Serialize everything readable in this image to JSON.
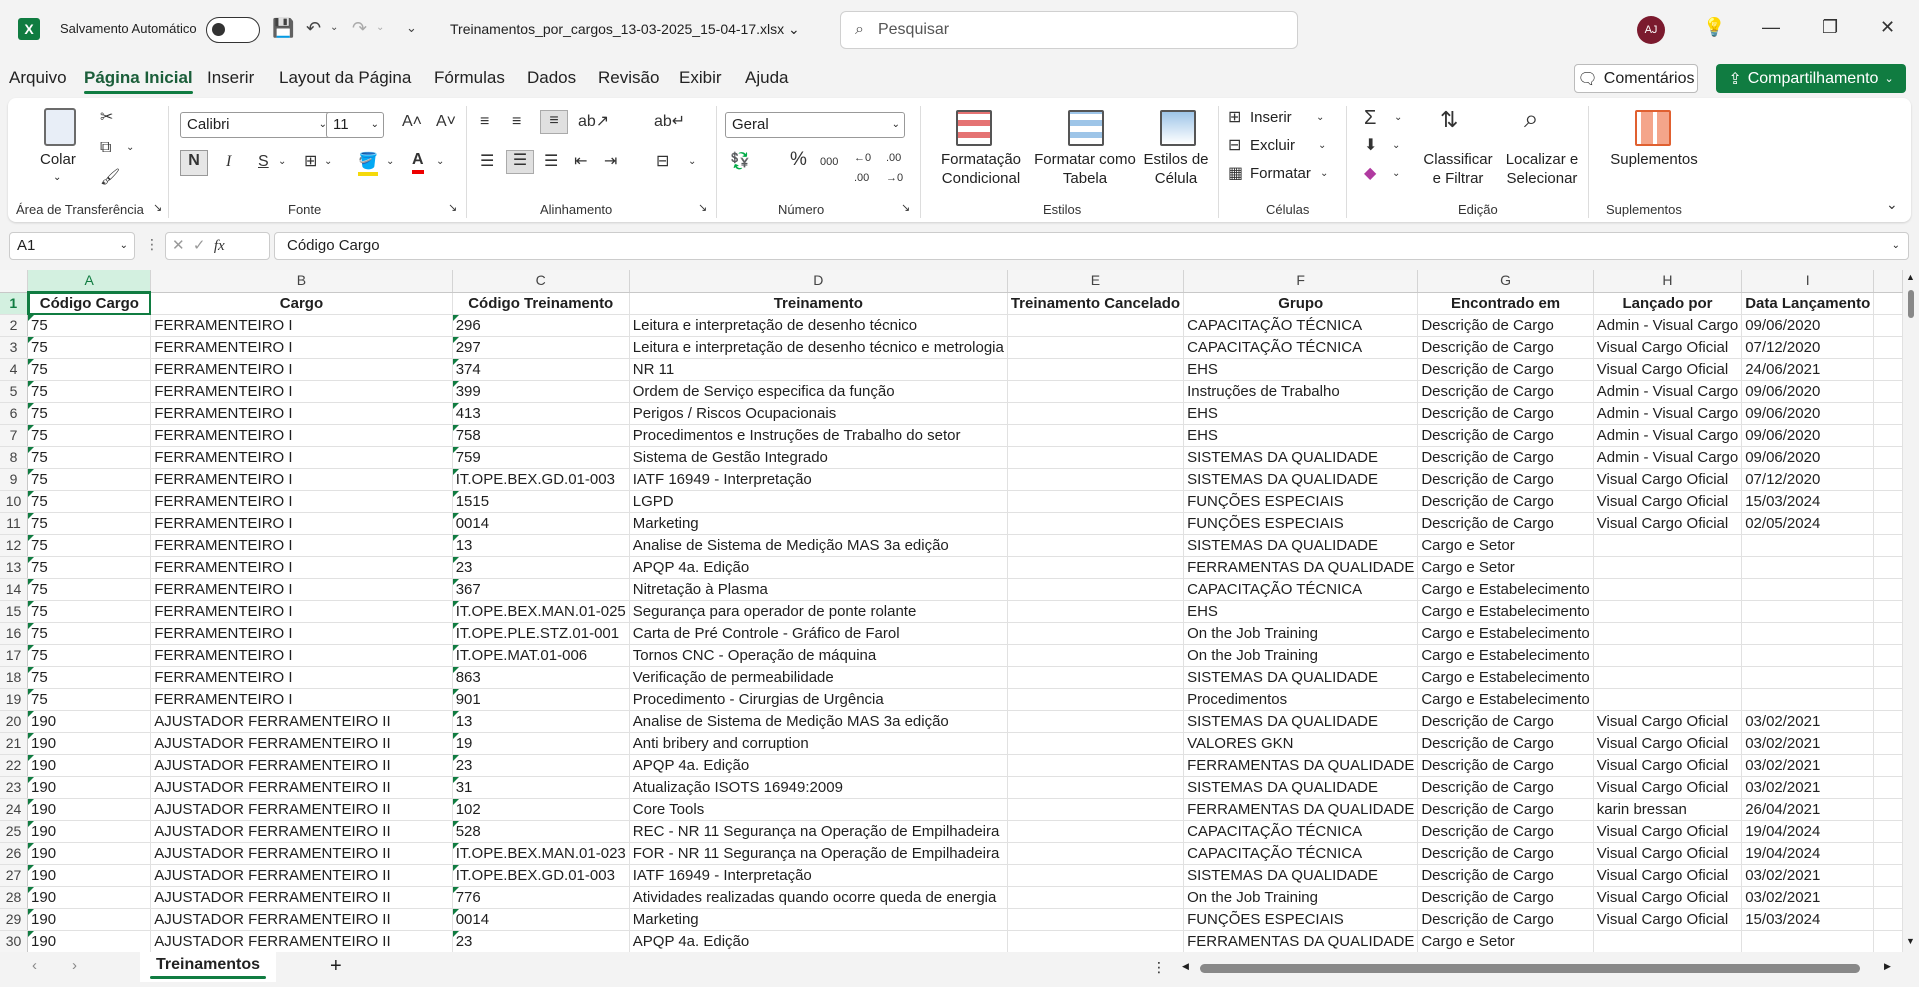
{
  "titlebar": {
    "logo": "X",
    "autosave_label": "Salvamento Automático",
    "filename": "Treinamentos_por_cargos_13-03-2025_15-04-17.xlsx",
    "search_placeholder": "Pesquisar",
    "avatar_initials": "AJ"
  },
  "menu": {
    "tabs": [
      "Arquivo",
      "Página Inicial",
      "Inserir",
      "Layout da Página",
      "Fórmulas",
      "Dados",
      "Revisão",
      "Exibir",
      "Ajuda"
    ],
    "active_tab": "Página Inicial",
    "comments": "Comentários",
    "share": "Compartilhamento"
  },
  "ribbon": {
    "clipboard": {
      "paste": "Colar",
      "label": "Área de Transferência"
    },
    "font": {
      "name": "Calibri",
      "size": "11",
      "label": "Fonte"
    },
    "alignment": {
      "label": "Alinhamento"
    },
    "number": {
      "format": "Geral",
      "label": "Número"
    },
    "styles": {
      "conditional": "Formatação Condicional",
      "table": "Formatar como Tabela",
      "cell": "Estilos de Célula",
      "label": "Estilos"
    },
    "cells": {
      "insert": "Inserir",
      "delete": "Excluir",
      "format": "Formatar",
      "label": "Células"
    },
    "editing": {
      "sort": "Classificar e Filtrar",
      "find": "Localizar e Selecionar",
      "label": "Edição"
    },
    "addins": {
      "addins": "Suplementos",
      "label": "Suplementos"
    }
  },
  "formula_bar": {
    "name_box": "A1",
    "formula": "Código Cargo"
  },
  "grid": {
    "columns": [
      "A",
      "B",
      "C",
      "D",
      "E",
      "F",
      "G",
      "H",
      "I"
    ],
    "headers": [
      "Código Cargo",
      "Cargo",
      "Código Treinamento",
      "Treinamento",
      "Treinamento Cancelado",
      "Grupo",
      "Encontrado em",
      "Lançado por",
      "Data Lançamento"
    ],
    "rows": [
      [
        "75",
        "FERRAMENTEIRO I",
        "296",
        "Leitura e interpretação de desenho técnico",
        "",
        "CAPACITAÇÃO TÉCNICA",
        "Descrição de Cargo",
        "Admin - Visual Cargo",
        "09/06/2020"
      ],
      [
        "75",
        "FERRAMENTEIRO I",
        "297",
        "Leitura e interpretação de desenho técnico e metrologia",
        "",
        "CAPACITAÇÃO TÉCNICA",
        "Descrição de Cargo",
        "Visual Cargo Oficial",
        "07/12/2020"
      ],
      [
        "75",
        "FERRAMENTEIRO I",
        "374",
        "NR 11",
        "",
        "EHS",
        "Descrição de Cargo",
        "Visual Cargo Oficial",
        "24/06/2021"
      ],
      [
        "75",
        "FERRAMENTEIRO I",
        "399",
        "Ordem de Serviço especifica da função",
        "",
        "Instruções de Trabalho",
        "Descrição de Cargo",
        "Admin - Visual Cargo",
        "09/06/2020"
      ],
      [
        "75",
        "FERRAMENTEIRO I",
        "413",
        "Perigos / Riscos Ocupacionais",
        "",
        "EHS",
        "Descrição de Cargo",
        "Admin - Visual Cargo",
        "09/06/2020"
      ],
      [
        "75",
        "FERRAMENTEIRO I",
        "758",
        "Procedimentos e Instruções de Trabalho do setor",
        "",
        "EHS",
        "Descrição de Cargo",
        "Admin - Visual Cargo",
        "09/06/2020"
      ],
      [
        "75",
        "FERRAMENTEIRO I",
        "759",
        "Sistema de Gestão Integrado",
        "",
        "SISTEMAS DA QUALIDADE",
        "Descrição de Cargo",
        "Admin - Visual Cargo",
        "09/06/2020"
      ],
      [
        "75",
        "FERRAMENTEIRO I",
        "IT.OPE.BEX.GD.01-003",
        "IATF 16949  - Interpretação",
        "",
        "SISTEMAS DA QUALIDADE",
        "Descrição de Cargo",
        "Visual Cargo Oficial",
        "07/12/2020"
      ],
      [
        "75",
        "FERRAMENTEIRO I",
        "1515",
        "LGPD",
        "",
        "FUNÇÕES ESPECIAIS",
        "Descrição de Cargo",
        "Visual Cargo Oficial",
        "15/03/2024"
      ],
      [
        "75",
        "FERRAMENTEIRO I",
        "0014",
        "Marketing",
        "",
        "FUNÇÕES ESPECIAIS",
        "Descrição de Cargo",
        "Visual Cargo Oficial",
        "02/05/2024"
      ],
      [
        "75",
        "FERRAMENTEIRO I",
        "13",
        "Analise de Sistema de Medição MAS 3a edição",
        "",
        "SISTEMAS DA QUALIDADE",
        "Cargo e Setor",
        "",
        ""
      ],
      [
        "75",
        "FERRAMENTEIRO I",
        "23",
        "APQP 4a. Edição",
        "",
        "FERRAMENTAS DA QUALIDADE",
        "Cargo e Setor",
        "",
        ""
      ],
      [
        "75",
        "FERRAMENTEIRO I",
        "367",
        "Nitretação à Plasma",
        "",
        "CAPACITAÇÃO TÉCNICA",
        "Cargo e Estabelecimento",
        "",
        ""
      ],
      [
        "75",
        "FERRAMENTEIRO I",
        "IT.OPE.BEX.MAN.01-025",
        "Segurança para operador de ponte rolante",
        "",
        "EHS",
        "Cargo e Estabelecimento",
        "",
        ""
      ],
      [
        "75",
        "FERRAMENTEIRO I",
        "IT.OPE.PLE.STZ.01-001",
        "Carta de Pré Controle - Gráfico de Farol",
        "",
        "On the Job Training",
        "Cargo e Estabelecimento",
        "",
        ""
      ],
      [
        "75",
        "FERRAMENTEIRO I",
        "IT.OPE.MAT.01-006",
        "Tornos CNC - Operação de máquina",
        "",
        "On the Job Training",
        "Cargo e Estabelecimento",
        "",
        ""
      ],
      [
        "75",
        "FERRAMENTEIRO I",
        "863",
        "Verificação de permeabilidade",
        "",
        "SISTEMAS DA QUALIDADE",
        "Cargo e Estabelecimento",
        "",
        ""
      ],
      [
        "75",
        "FERRAMENTEIRO I",
        "901",
        "Procedimento - Cirurgias de Urgência",
        "",
        "Procedimentos",
        "Cargo e Estabelecimento",
        "",
        ""
      ],
      [
        "190",
        "AJUSTADOR FERRAMENTEIRO II",
        "13",
        "Analise de Sistema de Medição MAS 3a edição",
        "",
        "SISTEMAS DA QUALIDADE",
        "Descrição de Cargo",
        "Visual Cargo Oficial",
        "03/02/2021"
      ],
      [
        "190",
        "AJUSTADOR FERRAMENTEIRO II",
        "19",
        "Anti bribery and corruption",
        "",
        "VALORES GKN",
        "Descrição de Cargo",
        "Visual Cargo Oficial",
        "03/02/2021"
      ],
      [
        "190",
        "AJUSTADOR FERRAMENTEIRO II",
        "23",
        "APQP 4a. Edição",
        "",
        "FERRAMENTAS DA QUALIDADE",
        "Descrição de Cargo",
        "Visual Cargo Oficial",
        "03/02/2021"
      ],
      [
        "190",
        "AJUSTADOR FERRAMENTEIRO II",
        "31",
        "Atualização ISOTS 16949:2009",
        "",
        "SISTEMAS DA QUALIDADE",
        "Descrição de Cargo",
        "Visual Cargo Oficial",
        "03/02/2021"
      ],
      [
        "190",
        "AJUSTADOR FERRAMENTEIRO II",
        "102",
        "Core Tools",
        "",
        "FERRAMENTAS DA QUALIDADE",
        "Descrição de Cargo",
        "karin bressan",
        "26/04/2021"
      ],
      [
        "190",
        "AJUSTADOR FERRAMENTEIRO II",
        "528",
        "REC - NR 11 Segurança na Operação de Empilhadeira",
        "",
        "CAPACITAÇÃO TÉCNICA",
        "Descrição de Cargo",
        "Visual Cargo Oficial",
        "19/04/2024"
      ],
      [
        "190",
        "AJUSTADOR FERRAMENTEIRO II",
        "IT.OPE.BEX.MAN.01-023",
        "FOR - NR 11 Segurança na Operação de Empilhadeira",
        "",
        "CAPACITAÇÃO TÉCNICA",
        "Descrição de Cargo",
        "Visual Cargo Oficial",
        "19/04/2024"
      ],
      [
        "190",
        "AJUSTADOR FERRAMENTEIRO II",
        "IT.OPE.BEX.GD.01-003",
        "IATF 16949  - Interpretação",
        "",
        "SISTEMAS DA QUALIDADE",
        "Descrição de Cargo",
        "Visual Cargo Oficial",
        "03/02/2021"
      ],
      [
        "190",
        "AJUSTADOR FERRAMENTEIRO II",
        "776",
        "Atividades realizadas quando ocorre queda de energia",
        "",
        "On the Job Training",
        "Descrição de Cargo",
        "Visual Cargo Oficial",
        "03/02/2021"
      ],
      [
        "190",
        "AJUSTADOR FERRAMENTEIRO II",
        "0014",
        "Marketing",
        "",
        "FUNÇÕES ESPECIAIS",
        "Descrição de Cargo",
        "Visual Cargo Oficial",
        "15/03/2024"
      ],
      [
        "190",
        "AJUSTADOR FERRAMENTEIRO II",
        "23",
        "APQP 4a. Edição",
        "",
        "FERRAMENTAS DA QUALIDADE",
        "Cargo e Setor",
        "",
        ""
      ]
    ]
  },
  "sheets": {
    "active": "Treinamentos",
    "add": "+"
  }
}
